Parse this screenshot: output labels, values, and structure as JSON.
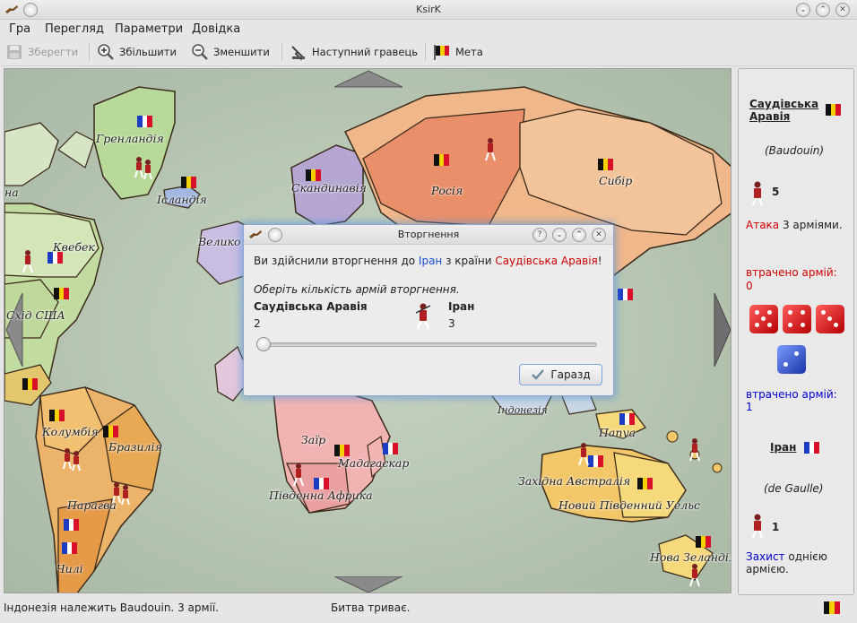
{
  "window": {
    "title": "KsirK"
  },
  "menu": [
    "Гра",
    "Перегляд",
    "Параметри",
    "Довідка"
  ],
  "toolbar": {
    "save": "Зберегти",
    "zoom_in": "Збільшити",
    "zoom_out": "Зменшити",
    "next_player": "Наступний гравець",
    "goal": "Мета"
  },
  "map": {
    "countries": [
      "Гренландія",
      "Ісландія",
      "Скандинавія",
      "Росія",
      "Сибір",
      "Квебек",
      "Велико",
      "Схід США",
      "Колумбія",
      "Бразилія",
      "Парагва",
      "Чилі",
      "Заїр",
      "Мадагаскар",
      "Південна Африка",
      "Індонезія",
      "Папуа",
      "Західна Австралія",
      "Новий Південний Уельс",
      "Нова Зеландія",
      "на"
    ]
  },
  "dialog": {
    "title": "Вторгнення",
    "msg_prefix": "Ви здійснили вторгнення до ",
    "target": "Іран",
    "msg_mid": " з країни ",
    "source": "Саудівська Аравія",
    "msg_end": "!",
    "instruction": "Оберіть кількість армій вторгнення.",
    "left_name": "Саудівська Аравія",
    "left_count": "2",
    "right_name": "Іран",
    "right_count": "3",
    "slider_value": 0,
    "ok_label": "Гаразд"
  },
  "panel": {
    "attacker_country": "Саудівська Аравія",
    "attacker_player": "(Baudouin)",
    "attacker_armies": "5",
    "attack_word": "Атака",
    "attack_rest": " 3 арміями.",
    "att_lost_label": "втрачено армій:",
    "att_lost": "0",
    "def_lost_label": "втрачено армій:",
    "def_lost": "1",
    "defender_country": "Іран",
    "defender_player": "(de Gaulle)",
    "defender_armies": "1",
    "defense_word": "Захист",
    "defense_rest": " однією армією."
  },
  "status": {
    "left": "Індонезія належить Baudouin. 3 армії.",
    "center": "Битва триває."
  },
  "colors": {
    "attack_red": "#cc0000",
    "defense_blue": "#0000cc",
    "link_blue": "#1a4bd1"
  }
}
